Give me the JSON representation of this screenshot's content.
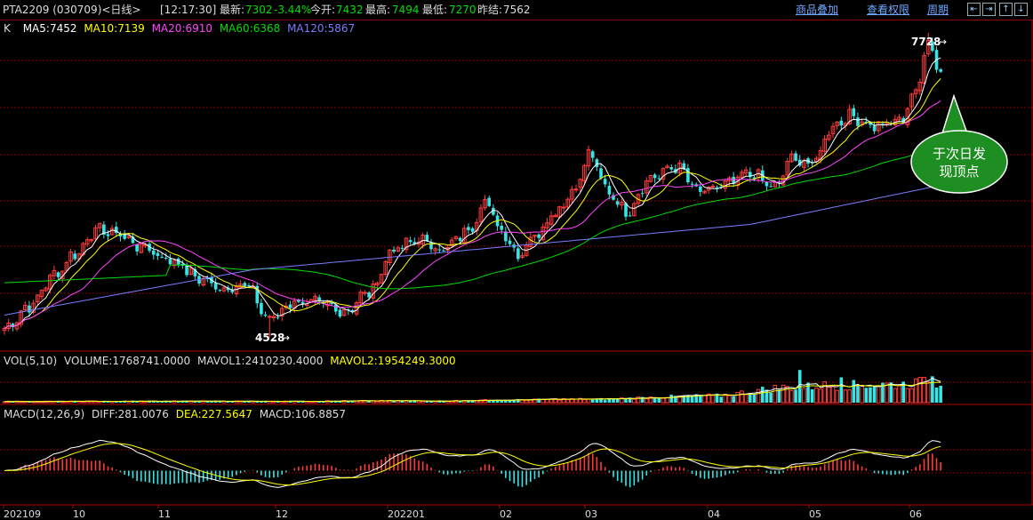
{
  "colors": {
    "up": "#ff3b3b",
    "down": "#34e6e6",
    "ma5": "#ffffff",
    "ma10": "#ffff00",
    "ma20": "#ff44ff",
    "ma60": "#00dd00",
    "ma120": "#7b7bff",
    "grid": "#8b0000",
    "label_gray": "#dddddd",
    "label_green": "#00dd00",
    "label_yellow": "#ffff00",
    "label_cyan": "#00c0c0",
    "callout_fill": "#1e8e22"
  },
  "header": {
    "title": "PTA2209 (030709)<日线>",
    "time": "[12:17:30]",
    "latest_label": "最新:",
    "latest_value": "7302",
    "change": "-3.44%",
    "open_label": "今开:",
    "open_value": "7432",
    "high_label": "最高:",
    "high_value": "7494",
    "low_label": "最低:",
    "low_value": "7270",
    "prev_label": "昨结:",
    "prev_value": "7562"
  },
  "menu": {
    "overlay": "商品叠加",
    "rights": "查看权限",
    "period": "周期"
  },
  "nav_buttons": [
    "⇤",
    "⇥",
    "↑",
    "↓"
  ],
  "price_legend": {
    "k_label": "K",
    "ma5": "MA5:7452",
    "ma10": "MA10:7139",
    "ma20": "MA20:6910",
    "ma60": "MA60:6368",
    "ma120": "MA120:5867"
  },
  "volume_legend": {
    "name": "VOL(5,10)",
    "volume": "VOLUME:1768741.0000",
    "mavol1": "MAVOL1:2410230.4000",
    "mavol2": "MAVOL2:1954249.3000"
  },
  "macd_legend": {
    "name": "MACD(12,26,9)",
    "diff": "DIFF:281.0076",
    "dea": "DEA:227.5647",
    "macd": "MACD:106.8857"
  },
  "annotations": {
    "high_label": "7728",
    "low_label": "4528",
    "callout": [
      "于次日发",
      "现顶点"
    ]
  },
  "chart_data": {
    "type": "candlestick",
    "price_range": [
      4400,
      7850
    ],
    "x_axis_labels": [
      "202109",
      "10",
      "11",
      "12",
      "202201",
      "02",
      "03",
      "04",
      "05",
      "06"
    ],
    "volume_range": [
      0,
      3200000
    ],
    "macd_range": [
      -350,
      380
    ],
    "key_points": [
      {
        "date_approx": "2021-12-06",
        "low": 4528
      },
      {
        "date_approx": "2022-06-08",
        "high": 7728
      }
    ],
    "anchors": [
      {
        "i": 0,
        "p": 4620
      },
      {
        "i": 6,
        "p": 4850
      },
      {
        "i": 12,
        "p": 5180
      },
      {
        "i": 17,
        "p": 5400
      },
      {
        "i": 22,
        "p": 5650
      },
      {
        "i": 27,
        "p": 5620
      },
      {
        "i": 33,
        "p": 5480
      },
      {
        "i": 40,
        "p": 5340
      },
      {
        "i": 47,
        "p": 5150
      },
      {
        "i": 52,
        "p": 5040
      },
      {
        "i": 58,
        "p": 5080
      },
      {
        "i": 64,
        "p": 4720
      },
      {
        "i": 70,
        "p": 4900
      },
      {
        "i": 76,
        "p": 4880
      },
      {
        "i": 82,
        "p": 4800
      },
      {
        "i": 88,
        "p": 5000
      },
      {
        "i": 94,
        "p": 5450
      },
      {
        "i": 100,
        "p": 5550
      },
      {
        "i": 106,
        "p": 5450
      },
      {
        "i": 112,
        "p": 5650
      },
      {
        "i": 116,
        "p": 5950
      },
      {
        "i": 120,
        "p": 5650
      },
      {
        "i": 124,
        "p": 5400
      },
      {
        "i": 128,
        "p": 5600
      },
      {
        "i": 133,
        "p": 5850
      },
      {
        "i": 138,
        "p": 6100
      },
      {
        "i": 141,
        "p": 6450
      },
      {
        "i": 146,
        "p": 6050
      },
      {
        "i": 150,
        "p": 5850
      },
      {
        "i": 156,
        "p": 6200
      },
      {
        "i": 162,
        "p": 6320
      },
      {
        "i": 168,
        "p": 6050
      },
      {
        "i": 174,
        "p": 6130
      },
      {
        "i": 180,
        "p": 6250
      },
      {
        "i": 186,
        "p": 6100
      },
      {
        "i": 190,
        "p": 6400
      },
      {
        "i": 195,
        "p": 6350
      },
      {
        "i": 200,
        "p": 6750
      },
      {
        "i": 204,
        "p": 6850
      },
      {
        "i": 210,
        "p": 6750
      },
      {
        "i": 216,
        "p": 6800
      },
      {
        "i": 220,
        "p": 7100
      },
      {
        "i": 223,
        "p": 7650
      },
      {
        "i": 226,
        "p": 7300
      }
    ],
    "volume_anchors": [
      {
        "i": 0,
        "v": 120000
      },
      {
        "i": 60,
        "v": 140000
      },
      {
        "i": 100,
        "v": 170000
      },
      {
        "i": 140,
        "v": 330000
      },
      {
        "i": 170,
        "v": 650000
      },
      {
        "i": 190,
        "v": 1450000
      },
      {
        "i": 200,
        "v": 1650000
      },
      {
        "i": 215,
        "v": 1750000
      },
      {
        "i": 226,
        "v": 1950000
      }
    ],
    "volume_spikes": [
      {
        "i": 192,
        "v": 3100000
      },
      {
        "i": 202,
        "v": 2400000
      },
      {
        "i": 222,
        "v": 2400000
      },
      {
        "i": 224,
        "v": 2500000
      },
      {
        "i": 205,
        "v": 2150000
      }
    ]
  }
}
